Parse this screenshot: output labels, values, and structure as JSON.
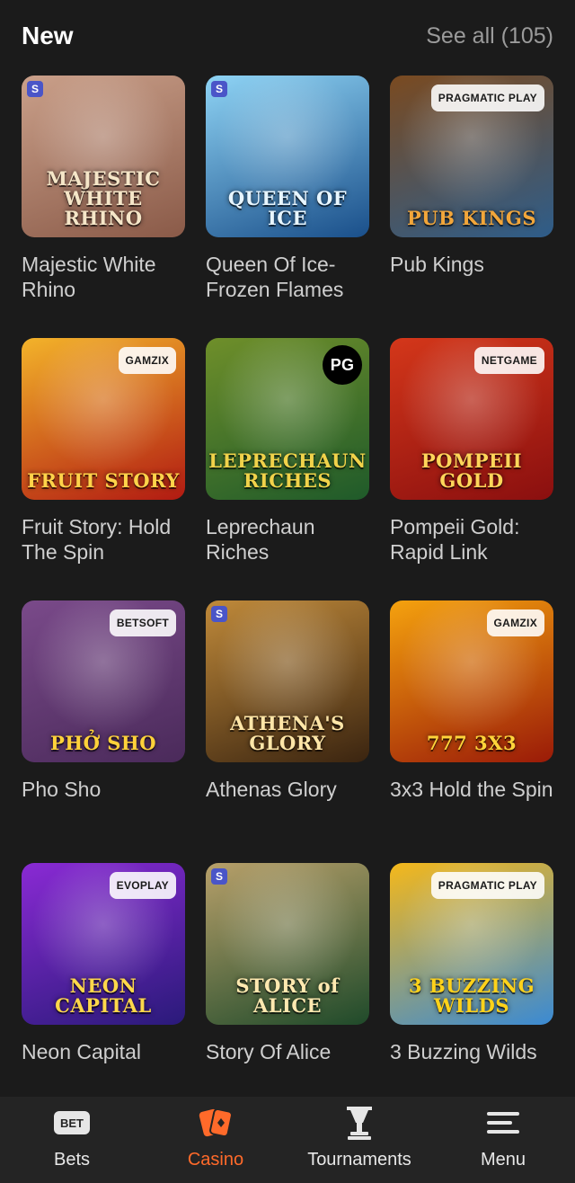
{
  "section": {
    "title": "New",
    "see_all": "See all (105)"
  },
  "games": [
    {
      "name": "Majestic White Rhino",
      "logo": "MAJESTIC WHITE RHINO",
      "provider": "",
      "colors": [
        "#8a5a48",
        "#caa08a"
      ],
      "logo_color": "#f5e6c8"
    },
    {
      "name": "Queen Of Ice-Frozen Flames",
      "logo": "QUEEN OF ICE",
      "provider": "",
      "colors": [
        "#1a4f8a",
        "#8fd4f5"
      ],
      "logo_color": "#e8f6ff"
    },
    {
      "name": "Pub Kings",
      "logo": "PUB KINGS",
      "provider": "PRAGMATIC PLAY",
      "colors": [
        "#2e5d8a",
        "#7a4a20"
      ],
      "logo_color": "#f2a63a"
    },
    {
      "name": "Fruit Story: Hold The Spin",
      "logo": "FRUIT STORY",
      "provider": "GAMZIX",
      "colors": [
        "#b11a12",
        "#f3b32a"
      ],
      "logo_color": "#ffd34a"
    },
    {
      "name": "Leprechaun Riches",
      "logo": "LEPRECHAUN RICHES",
      "provider": "PG",
      "colors": [
        "#1f5a2a",
        "#6f8f2a"
      ],
      "logo_color": "#f1d24a"
    },
    {
      "name": "Pompeii Gold: Rapid Link",
      "logo": "POMPEII GOLD",
      "provider": "NETGAME",
      "colors": [
        "#8a0f0f",
        "#d4371a"
      ],
      "logo_color": "#ffd65a"
    },
    {
      "name": "Pho Sho",
      "logo": "PHỞ SHO",
      "provider": "BETSOFT",
      "colors": [
        "#4a2a5a",
        "#7a4a8a"
      ],
      "logo_color": "#ffd23a"
    },
    {
      "name": "Athenas Glory",
      "logo": "ATHENA'S GLORY",
      "provider": "",
      "colors": [
        "#3a2410",
        "#c08a3a"
      ],
      "logo_color": "#ffe6a8"
    },
    {
      "name": "3x3 Hold the Spin",
      "logo": "777 3X3",
      "provider": "GAMZIX",
      "colors": [
        "#9a1a08",
        "#f5a20e"
      ],
      "logo_color": "#ffd43a"
    },
    {
      "name": "Neon Capital",
      "logo": "NEON CAPITAL",
      "provider": "EVOPLAY",
      "colors": [
        "#2a1a7a",
        "#8a2ad4"
      ],
      "logo_color": "#ffd84a"
    },
    {
      "name": "Story Of Alice",
      "logo": "STORY of ALICE",
      "provider": "",
      "colors": [
        "#1f4a2a",
        "#b8a06a"
      ],
      "logo_color": "#ffe9b0"
    },
    {
      "name": "3 Buzzing Wilds",
      "logo": "3 BUZZING WILDS",
      "provider": "PRAGMATIC PLAY",
      "colors": [
        "#3a8ad4",
        "#f5b81a"
      ],
      "logo_color": "#ffd21a"
    }
  ],
  "nav": {
    "bets": "Bets",
    "casino": "Casino",
    "tournaments": "Tournaments",
    "menu": "Menu",
    "active_color": "#ff6a2a"
  }
}
